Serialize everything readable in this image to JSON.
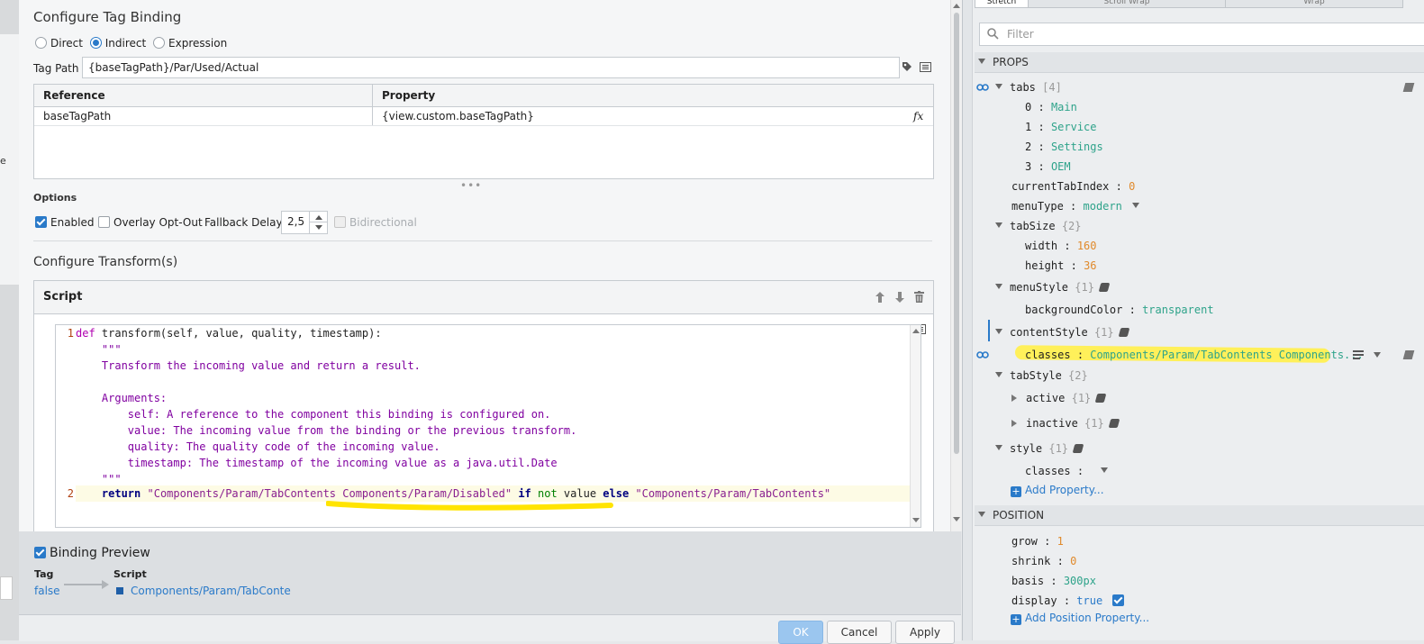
{
  "left_strip": {
    "glyph": "e"
  },
  "dialog": {
    "title": "Configure Tag Binding",
    "binding_types": [
      {
        "label": "Direct",
        "selected": false
      },
      {
        "label": "Indirect",
        "selected": true
      },
      {
        "label": "Expression",
        "selected": false
      }
    ],
    "tag_path_label": "Tag Path",
    "tag_path_value": "{baseTagPath}/Par/Used/Actual",
    "reference_table": {
      "headers": [
        "Reference",
        "Property"
      ],
      "rows": [
        {
          "reference": "baseTagPath",
          "property": "{view.custom.baseTagPath}"
        }
      ],
      "fx_label": "fx"
    },
    "options": {
      "heading": "Options",
      "enabled_label": "Enabled",
      "enabled_checked": true,
      "overlay_label": "Overlay Opt-Out",
      "overlay_checked": false,
      "fallback_label": "Fallback Delay",
      "fallback_value": "2,5",
      "bidirectional_label": "Bidirectional"
    },
    "transforms_title": "Configure Transform(s)",
    "script_title": "Script",
    "code": {
      "line1_no": "1",
      "line1_def": "def",
      "line1_sig": " transform(self, value, quality, timestamp):",
      "doc_open": "    \"\"\"",
      "doc_1": "    Transform the incoming value and return a result.",
      "doc_2": "    Arguments:",
      "doc_3": "        self: A reference to the component this binding is configured on.",
      "doc_4": "        value: The incoming value from the binding or the previous transform.",
      "doc_5": "        quality: The quality code of the incoming value.",
      "doc_6": "        timestamp: The timestamp of the incoming value as a java.util.Date",
      "doc_close": "    \"\"\"",
      "line2_no": "2",
      "line2_return": "return",
      "line2_str1": "\"Components/Param/TabContents Components/Param/Disabled\"",
      "line2_if": "if",
      "line2_not": "not",
      "line2_value": "value",
      "line2_else": "else",
      "line2_str2": "\"Components/Param/TabContents\""
    },
    "preview": {
      "label": "Binding Preview",
      "checked": true,
      "tag_label": "Tag",
      "tag_value": "false",
      "script_label": "Script",
      "script_value": "Components/Param/TabConten"
    },
    "buttons": {
      "ok": "OK",
      "cancel": "Cancel",
      "apply": "Apply"
    }
  },
  "props_panel": {
    "top_tabs": [
      "Stretch",
      "Scroll Wrap",
      "Wrap"
    ],
    "filter_placeholder": "Filter",
    "props_heading": "PROPS",
    "tabs_key": "tabs",
    "tabs_count": "[4]",
    "tab_items": [
      {
        "index": "0",
        "value": "Main"
      },
      {
        "index": "1",
        "value": "Service"
      },
      {
        "index": "2",
        "value": "Settings"
      },
      {
        "index": "3",
        "value": "OEM"
      }
    ],
    "currentTabIndex": {
      "key": "currentTabIndex",
      "value": "0"
    },
    "menuType": {
      "key": "menuType",
      "value": "modern"
    },
    "tabSize": {
      "key": "tabSize",
      "count": "{2}",
      "width_key": "width",
      "width": "160",
      "height_key": "height",
      "height": "36"
    },
    "menuStyle": {
      "key": "menuStyle",
      "count": "{1}",
      "bg_key": "backgroundColor",
      "bg": "transparent"
    },
    "contentStyle": {
      "key": "contentStyle",
      "count": "{1}",
      "classes_key": "classes",
      "classes": "Components/Param/TabContents Components..."
    },
    "tabStyle": {
      "key": "tabStyle",
      "count": "{2}",
      "active_key": "active",
      "active_count": "{1}",
      "inactive_key": "inactive",
      "inactive_count": "{1}"
    },
    "style": {
      "key": "style",
      "count": "{1}",
      "classes_key": "classes"
    },
    "add_property": "Add Property...",
    "position_heading": "POSITION",
    "position": {
      "grow_key": "grow",
      "grow": "1",
      "shrink_key": "shrink",
      "shrink": "0",
      "basis_key": "basis",
      "basis": "300px",
      "display_key": "display",
      "display": "true"
    },
    "add_position_property": "Add Position Property...",
    "colon": ":"
  }
}
